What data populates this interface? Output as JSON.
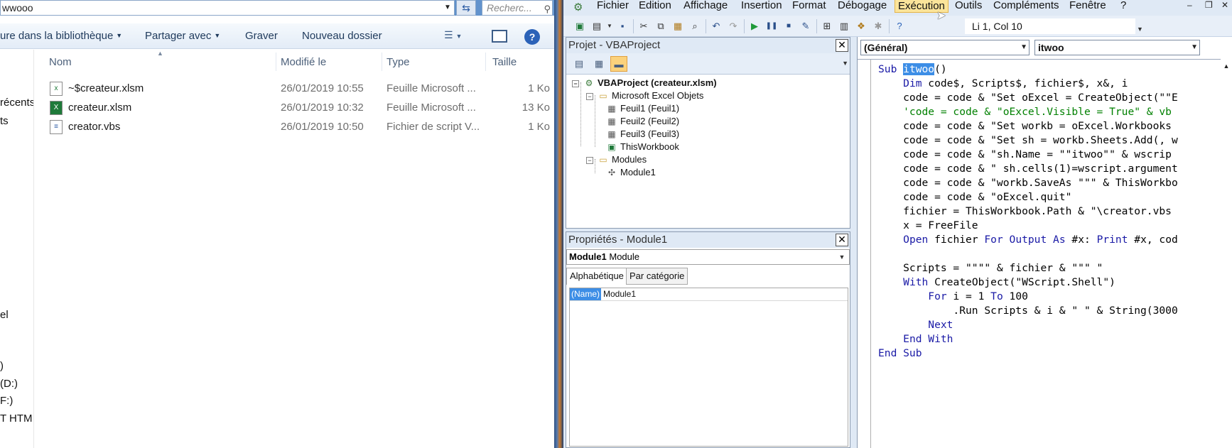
{
  "explorer": {
    "path_text": "wwooo",
    "search_placeholder": "Recherc...",
    "toolbar": {
      "library_label": "ure dans la bibliothèque",
      "share_label": "Partager avec",
      "burn_label": "Graver",
      "new_folder_label": "Nouveau dossier"
    },
    "nav_items": [
      "récents",
      "ts",
      "el",
      ")",
      "(D:)",
      "F:)",
      "T HTM"
    ],
    "columns": {
      "name": "Nom",
      "modified": "Modifié le",
      "type": "Type",
      "size": "Taille"
    },
    "files": [
      {
        "name": "~$createur.xlsm",
        "modified": "26/01/2019 10:55",
        "type": "Feuille Microsoft ...",
        "size": "1 Ko",
        "icon": "excel-temp-file-icon"
      },
      {
        "name": "createur.xlsm",
        "modified": "26/01/2019 10:32",
        "type": "Feuille Microsoft ...",
        "size": "13 Ko",
        "icon": "excel-file-icon"
      },
      {
        "name": "creator.vbs",
        "modified": "26/01/2019 10:50",
        "type": "Fichier de script V...",
        "size": "1 Ko",
        "icon": "vbscript-file-icon"
      }
    ]
  },
  "vbe": {
    "menu": [
      "Fichier",
      "Edition",
      "Affichage",
      "Insertion",
      "Format",
      "Débogage",
      "Exécution",
      "Outils",
      "Compléments",
      "Fenêtre",
      "?"
    ],
    "active_menu": "Exécution",
    "cursor_position": "Li 1, Col 10",
    "project_panel": {
      "title": "Projet - VBAProject",
      "tree": [
        {
          "label": "VBAProject (createur.xlsm)",
          "level": 0,
          "expander": "⊟",
          "icon": "vba-project-icon",
          "bold": true
        },
        {
          "label": "Microsoft Excel Objets",
          "level": 1,
          "expander": "⊟",
          "icon": "folder-icon",
          "bold": false
        },
        {
          "label": "Feuil1 (Feuil1)",
          "level": 2,
          "expander": "",
          "icon": "sheet-icon",
          "bold": false
        },
        {
          "label": "Feuil2 (Feuil2)",
          "level": 2,
          "expander": "",
          "icon": "sheet-icon",
          "bold": false
        },
        {
          "label": "Feuil3 (Feuil3)",
          "level": 2,
          "expander": "",
          "icon": "sheet-icon",
          "bold": false
        },
        {
          "label": "ThisWorkbook",
          "level": 2,
          "expander": "",
          "icon": "workbook-icon",
          "bold": false
        },
        {
          "label": "Modules",
          "level": 1,
          "expander": "⊟",
          "icon": "folder-icon",
          "bold": false
        },
        {
          "label": "Module1",
          "level": 2,
          "expander": "",
          "icon": "module-icon",
          "bold": false
        }
      ]
    },
    "properties_panel": {
      "title": "Propriétés - Module1",
      "object_name": "Module1",
      "object_type": "Module",
      "tab_alpha": "Alphabétique",
      "tab_category": "Par catégorie",
      "prop_key": "(Name)",
      "prop_value": "Module1"
    },
    "code_window": {
      "object_combo": "(Général)",
      "procedure_combo": "itwoo",
      "lines": [
        [
          {
            "t": "Sub ",
            "c": "kw"
          },
          {
            "t": "itwoo",
            "c": "sel"
          },
          {
            "t": "()",
            "c": ""
          }
        ],
        [
          {
            "t": "    ",
            "c": ""
          },
          {
            "t": "Dim",
            "c": "kw"
          },
          {
            "t": " code$, Scripts$, fichier$, x&, i",
            "c": ""
          }
        ],
        [
          {
            "t": "    code = code & \"Set oExcel = CreateObject(\"\"E",
            "c": ""
          }
        ],
        [
          {
            "t": "    'code = code & \"oExcel.Visible = True\" & vb",
            "c": "cm"
          }
        ],
        [
          {
            "t": "    code = code & \"Set workb = oExcel.Workbooks",
            "c": ""
          }
        ],
        [
          {
            "t": "    code = code & \"Set sh = workb.Sheets.Add(, w",
            "c": ""
          }
        ],
        [
          {
            "t": "    code = code & \"sh.Name = \"\"itwoo\"\" & wscrip",
            "c": ""
          }
        ],
        [
          {
            "t": "    code = code & \" sh.cells(1)=wscript.argument",
            "c": ""
          }
        ],
        [
          {
            "t": "    code = code & \"workb.SaveAs \"\"\" & ThisWorkbo",
            "c": ""
          }
        ],
        [
          {
            "t": "    code = code & \"oExcel.quit\"",
            "c": ""
          }
        ],
        [
          {
            "t": "    fichier = ThisWorkbook.Path & \"\\creator.vbs",
            "c": ""
          }
        ],
        [
          {
            "t": "    x = FreeFile",
            "c": ""
          }
        ],
        [
          {
            "t": "    ",
            "c": ""
          },
          {
            "t": "Open",
            "c": "kw"
          },
          {
            "t": " fichier ",
            "c": ""
          },
          {
            "t": "For Output As",
            "c": "kw"
          },
          {
            "t": " #x: ",
            "c": ""
          },
          {
            "t": "Print",
            "c": "kw"
          },
          {
            "t": " #x, cod",
            "c": ""
          }
        ],
        [
          {
            "t": "",
            "c": ""
          }
        ],
        [
          {
            "t": "    Scripts = \"\"\"\" & fichier & \"\"\" \"",
            "c": ""
          }
        ],
        [
          {
            "t": "    ",
            "c": ""
          },
          {
            "t": "With",
            "c": "kw"
          },
          {
            "t": " CreateObject(\"WScript.Shell\")",
            "c": ""
          }
        ],
        [
          {
            "t": "        ",
            "c": ""
          },
          {
            "t": "For",
            "c": "kw"
          },
          {
            "t": " i = 1 ",
            "c": ""
          },
          {
            "t": "To",
            "c": "kw"
          },
          {
            "t": " 100",
            "c": ""
          }
        ],
        [
          {
            "t": "            .Run Scripts & i & \" \" & String(3000",
            "c": ""
          }
        ],
        [
          {
            "t": "        ",
            "c": ""
          },
          {
            "t": "Next",
            "c": "kw"
          }
        ],
        [
          {
            "t": "    ",
            "c": ""
          },
          {
            "t": "End With",
            "c": "kw"
          }
        ],
        [
          {
            "t": "End Sub",
            "c": "kw"
          }
        ]
      ]
    }
  }
}
